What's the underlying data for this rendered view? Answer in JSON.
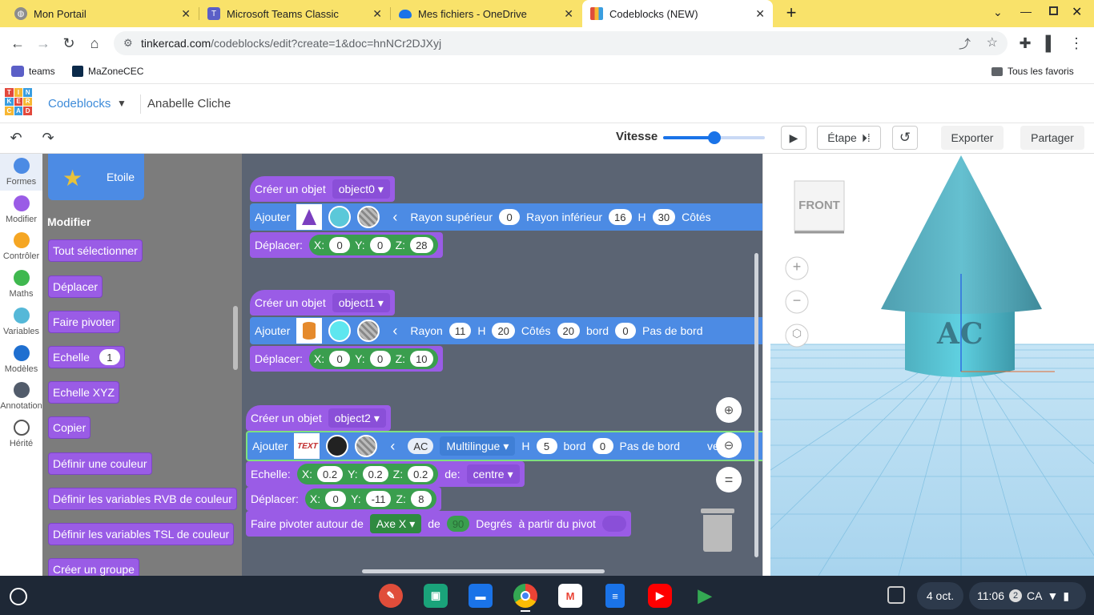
{
  "browser": {
    "tabs": [
      {
        "title": "Mon Portail",
        "icon": "globe-icon"
      },
      {
        "title": "Microsoft Teams Classic",
        "icon": "teams-icon"
      },
      {
        "title": "Mes fichiers - OneDrive",
        "icon": "onedrive-icon"
      },
      {
        "title": "Codeblocks (NEW)",
        "icon": "tinkercad-icon"
      }
    ],
    "url_host": "tinkercad.com",
    "url_path": "/codeblocks/edit?create=1&doc=hnNCr2DJXyj",
    "bookmarks": [
      "teams",
      "MaZoneCEC"
    ],
    "all_bookmarks": "Tous les favoris"
  },
  "app": {
    "logo_letters": [
      "T",
      "I",
      "N",
      "K",
      "E",
      "R",
      "C",
      "A",
      "D"
    ],
    "name": "Codeblocks",
    "project": "Anabelle Cliche"
  },
  "toolbar": {
    "speed_label": "Vitesse",
    "speed_value": 0.5,
    "step_label": "Étape",
    "export_label": "Exporter",
    "share_label": "Partager"
  },
  "categories": [
    {
      "label": "Formes",
      "color": "#4c8be4"
    },
    {
      "label": "Modifier",
      "color": "#9a5ce6"
    },
    {
      "label": "Contrôler",
      "color": "#f5a623"
    },
    {
      "label": "Maths",
      "color": "#3fb84f"
    },
    {
      "label": "Variables",
      "color": "#55b8d8"
    },
    {
      "label": "Modèles",
      "color": "#1f6fd0"
    },
    {
      "label": "Annotation",
      "color": "#525c6b"
    },
    {
      "label": "Hérité",
      "color": "#ffffff"
    }
  ],
  "flyout": {
    "shape_label": "Etoile",
    "section_title": "Modifier",
    "items": [
      "Tout sélectionner",
      "Déplacer",
      "Faire pivoter",
      "Echelle",
      "Echelle XYZ",
      "Copier",
      "Définir une couleur",
      "Définir les variables RVB de couleur",
      "Définir les variables TSL de couleur",
      "Créer un groupe"
    ],
    "scale_value": "1"
  },
  "workspace": {
    "create_label": "Créer un objet",
    "add_label": "Ajouter",
    "move_label": "Déplacer:",
    "x": "X:",
    "y": "Y:",
    "z": "Z:",
    "group0": {
      "object": "object0",
      "top_radius_label": "Rayon supérieur",
      "top_radius": "0",
      "bottom_radius_label": "Rayon inférieur",
      "bottom_radius": "16",
      "h_label": "H",
      "h": "30",
      "sides_label": "Côtés",
      "move": {
        "x": "0",
        "y": "0",
        "z": "28"
      }
    },
    "group1": {
      "object": "object1",
      "radius_label": "Rayon",
      "radius": "11",
      "h_label": "H",
      "h": "20",
      "sides_label": "Côtés",
      "sides": "20",
      "edge_label": "bord",
      "edge": "0",
      "no_edge_label": "Pas de bord",
      "move": {
        "x": "0",
        "y": "0",
        "z": "10"
      }
    },
    "group2": {
      "object": "object2",
      "text": "AC",
      "font": "Multilingue",
      "h_label": "H",
      "h": "5",
      "edge_label": "bord",
      "edge": "0",
      "no_edge_label": "Pas de bord",
      "tail": "ve",
      "scale_label": "Echelle:",
      "scale": {
        "x": "0.2",
        "y": "0.2",
        "z": "0.2"
      },
      "from_label": "de:",
      "from_value": "centre",
      "move": {
        "x": "0",
        "y": "-11",
        "z": "8"
      },
      "rotate_label": "Faire pivoter autour de",
      "axis": "Axe X",
      "of_label": "de",
      "degrees": "90",
      "degrees_label": "Degrés",
      "pivot_label": "à partir du pivot"
    }
  },
  "viewport": {
    "viewcube_label": "FRONT",
    "model_text": "AC"
  },
  "taskbar": {
    "date": "4 oct.",
    "time": "11:06",
    "notif_count": "2",
    "locale": "CA"
  }
}
